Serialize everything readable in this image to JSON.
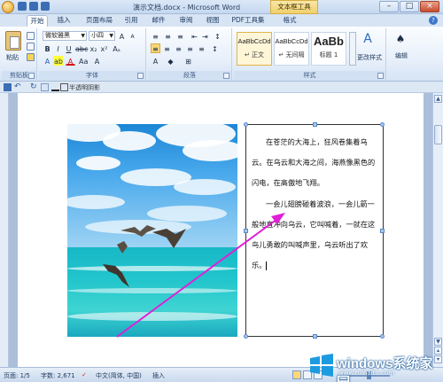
{
  "window": {
    "title": "演示文档.docx - Microsoft Word",
    "contextual_tool": "文本框工具",
    "minimize": "–",
    "maximize": "□",
    "close": "×"
  },
  "tabs": [
    "开始",
    "插入",
    "页面布局",
    "引用",
    "邮件",
    "审阅",
    "视图",
    "PDF工具集",
    "格式"
  ],
  "ribbon": {
    "clipboard": {
      "paste": "粘贴",
      "label": "剪贴板"
    },
    "font": {
      "name": "微软雅黑",
      "size": "小四",
      "label": "字体"
    },
    "paragraph": {
      "label": "段落"
    },
    "styles": {
      "items": [
        {
          "sample": "AaBbCcDd",
          "name": "↵ 正文"
        },
        {
          "sample": "AaBbCcDd",
          "name": "↵ 无间隔"
        },
        {
          "sample": "AaBb",
          "name": "标题 1"
        }
      ],
      "change": "更改样式",
      "label": "样式"
    },
    "editing": {
      "label": "编辑"
    }
  },
  "minibar": {
    "text": "半透明阴影"
  },
  "textbox": {
    "paragraphs": [
      "在苍茫的大海上，狂风卷集着乌云。在乌云和大海之间，海燕像黑色的闪电，在高傲地飞翔。",
      "一会儿翅膀碰着波浪，一会儿箭一般地直冲向乌云，它叫喊着，一就在这鸟儿勇敢的叫喊声里，乌云听出了欢乐。"
    ]
  },
  "status": {
    "page": "页面: 1/5",
    "words": "字数: 2,671",
    "language": "中文(简体, 中国)",
    "mode": "插入"
  },
  "watermark": {
    "brand": "windows系统家园",
    "url": "www.ruinaitu.com"
  },
  "colors": {
    "arrow": "#e020d8",
    "ribbon_tab_active": "#fdfeff",
    "contextual": "#f1cf6c"
  }
}
